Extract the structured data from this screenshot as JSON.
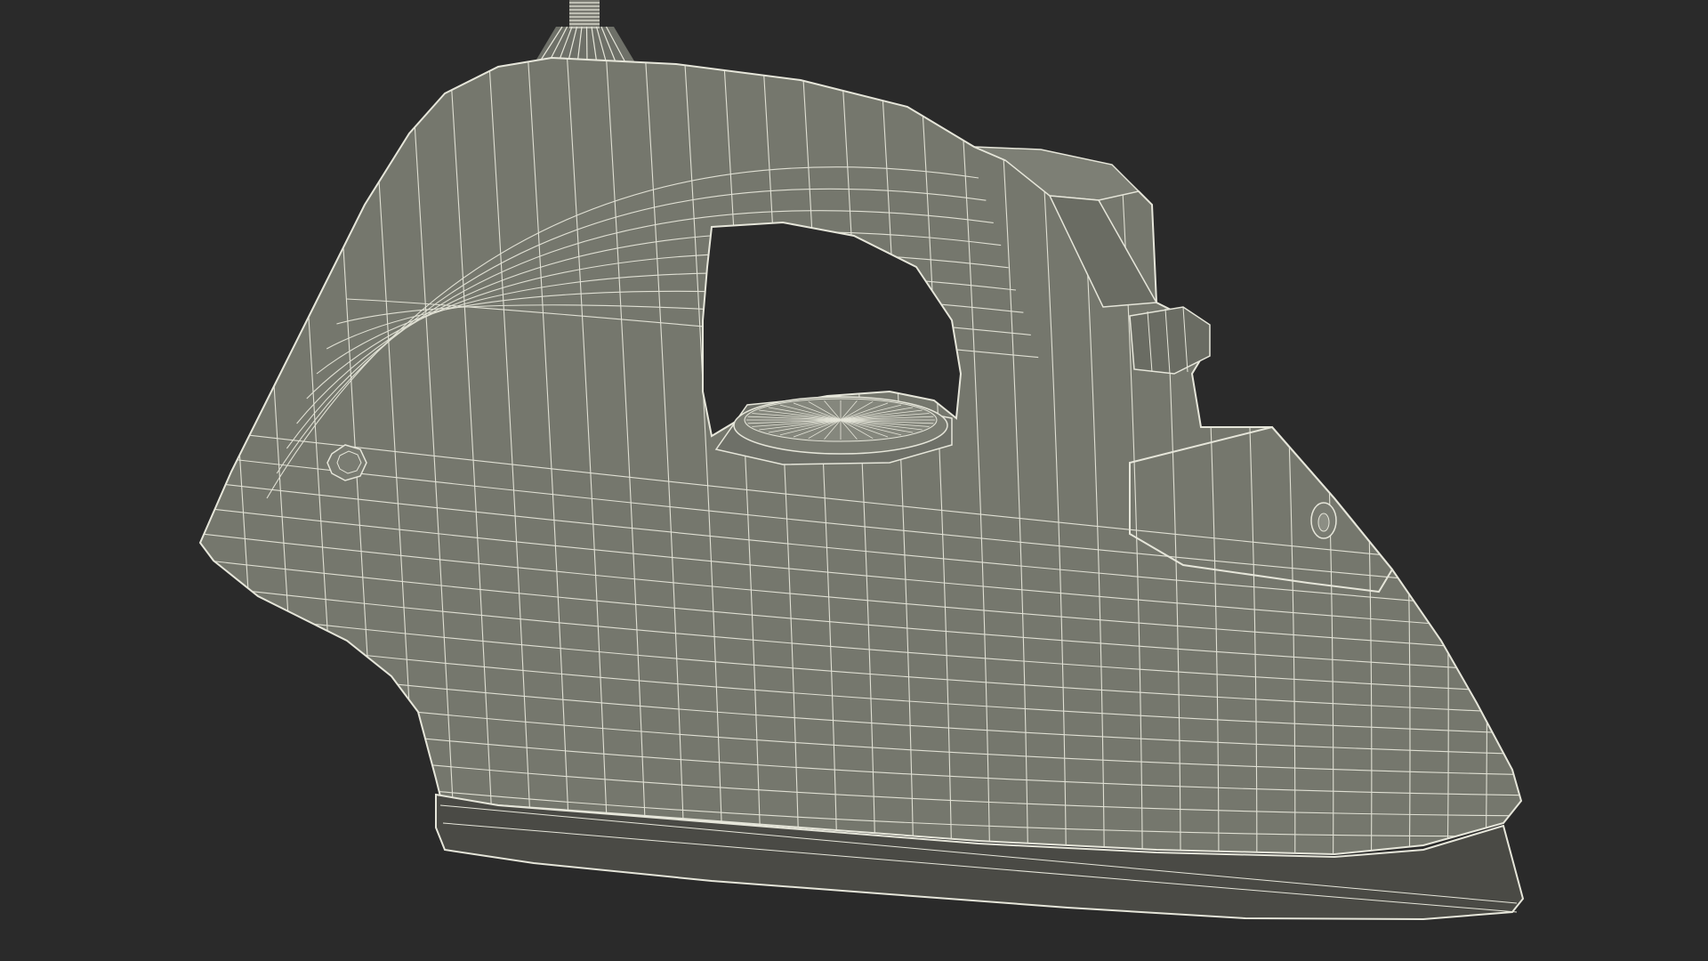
{
  "scene": {
    "subject": "clothes-iron-wireframe",
    "background_color": "#2a2a2a",
    "body_color": "#75776d",
    "body_shadow_color": "#5f6159",
    "wire_color": "#e6e6da",
    "soleplate_color": "#4a4a45"
  }
}
